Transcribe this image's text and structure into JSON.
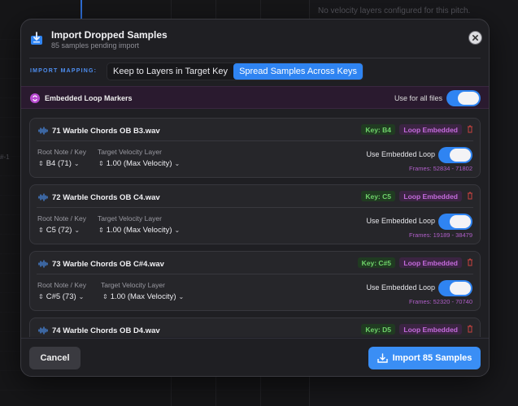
{
  "background": {
    "empty_message": "No velocity layers configured for this pitch.",
    "marker": "#-1"
  },
  "dialog": {
    "title": "Import Dropped Samples",
    "subtitle": "85 samples pending import",
    "icon": "import-tray-icon",
    "close_icon": "close-icon"
  },
  "mapping": {
    "label": "IMPORT MAPPING:",
    "options": [
      "Keep to Layers in Target Key",
      "Spread Samples Across Keys"
    ],
    "selected": "Spread Samples Across Keys"
  },
  "loop_markers": {
    "label": "Embedded Loop Markers",
    "use_for_all_label": "Use for all files",
    "use_for_all": true
  },
  "labels": {
    "root_note": "Root Note / Key",
    "target_velocity": "Target Velocity Layer",
    "use_embedded_loop": "Use Embedded Loop",
    "loop_embedded": "Loop Embedded"
  },
  "samples": [
    {
      "name": "71 Warble Chords OB B3.wav",
      "key_badge": "Key: B4",
      "root": "B4 (71)",
      "velocity": "1.00 (Max Velocity)",
      "use_loop": true,
      "frames": "Frames: 52834 - 71802"
    },
    {
      "name": "72 Warble Chords OB C4.wav",
      "key_badge": "Key: C5",
      "root": "C5 (72)",
      "velocity": "1.00 (Max Velocity)",
      "use_loop": true,
      "frames": "Frames: 19189 - 38479"
    },
    {
      "name": "73 Warble Chords OB C#4.wav",
      "key_badge": "Key: C#5",
      "root": "C#5 (73)",
      "velocity": "1.00 (Max Velocity)",
      "use_loop": true,
      "frames": "Frames: 52320 - 70740"
    },
    {
      "name": "74 Warble Chords OB D4.wav",
      "key_badge": "Key: D5"
    }
  ],
  "footer": {
    "cancel": "Cancel",
    "import": "Import 85 Samples"
  },
  "colors": {
    "accent": "#2f84f2",
    "key_badge": "#6fd26a",
    "loop_badge": "#c46bdc"
  }
}
